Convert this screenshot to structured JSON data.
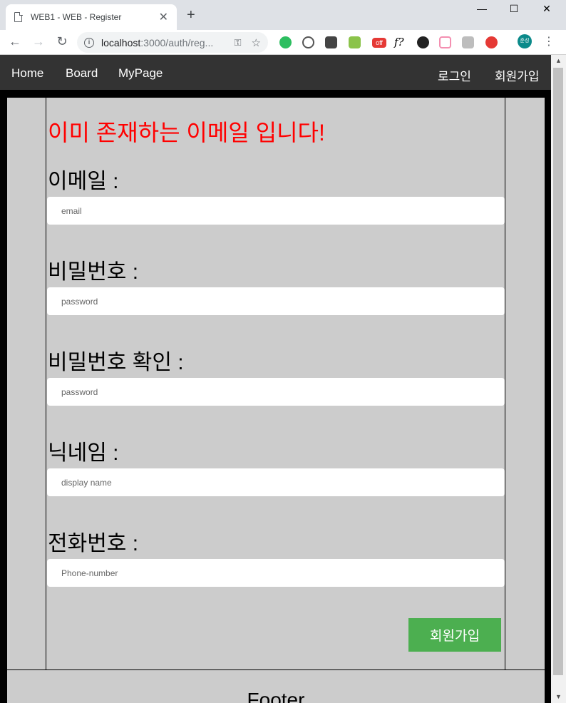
{
  "browser": {
    "tab_title": "WEB1 - WEB - Register",
    "tab_close": "✕",
    "new_tab": "+",
    "minimize": "—",
    "maximize": "☐",
    "close": "✕",
    "back": "←",
    "forward": "→",
    "reload": "↻",
    "url_host": "localhost",
    "url_path": ":3000/auth/reg...",
    "profile_label": "준성",
    "ext_off_label": "off",
    "ext_f_label": "f?"
  },
  "navbar": {
    "home": "Home",
    "board": "Board",
    "mypage": "MyPage",
    "login": "로그인",
    "signup": "회원가입"
  },
  "form": {
    "error": "이미 존재하는 이메일 입니다!",
    "email_label": "이메일 :",
    "email_placeholder": "email",
    "password_label": "비밀번호 :",
    "password_placeholder": "password",
    "password_confirm_label": "비밀번호 확인 :",
    "password_confirm_placeholder": "password",
    "nickname_label": "닉네임 :",
    "nickname_placeholder": "display name",
    "phone_label": "전화번호 :",
    "phone_placeholder": "Phone-number",
    "submit": "회원가입"
  },
  "footer": {
    "text": "Footer"
  },
  "colors": {
    "error": "#ff0000",
    "submit": "#4caf50",
    "navbar": "#333333",
    "content": "#cccccc"
  }
}
